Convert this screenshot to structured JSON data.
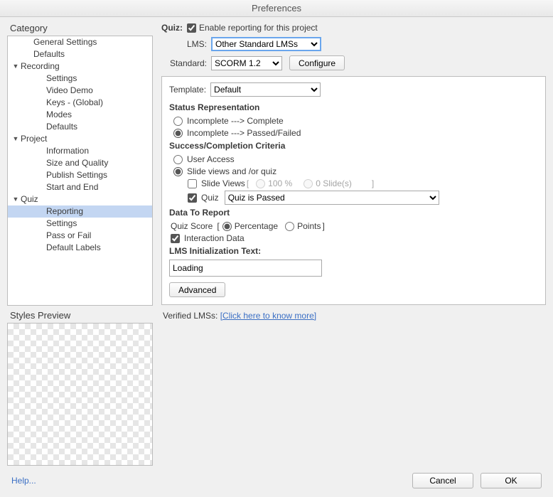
{
  "window": {
    "title": "Preferences"
  },
  "sidebar": {
    "heading": "Category",
    "preview_heading": "Styles Preview",
    "items": [
      {
        "label": "General Settings",
        "depth": 1,
        "arrow": ""
      },
      {
        "label": "Defaults",
        "depth": 1,
        "arrow": ""
      },
      {
        "label": "Recording",
        "depth": 0,
        "arrow": "▼"
      },
      {
        "label": "Settings",
        "depth": 2,
        "arrow": ""
      },
      {
        "label": "Video Demo",
        "depth": 2,
        "arrow": ""
      },
      {
        "label": "Keys - (Global)",
        "depth": 2,
        "arrow": ""
      },
      {
        "label": "Modes",
        "depth": 2,
        "arrow": ""
      },
      {
        "label": "Defaults",
        "depth": 2,
        "arrow": ""
      },
      {
        "label": "Project",
        "depth": 0,
        "arrow": "▼"
      },
      {
        "label": "Information",
        "depth": 2,
        "arrow": ""
      },
      {
        "label": "Size and Quality",
        "depth": 2,
        "arrow": ""
      },
      {
        "label": "Publish Settings",
        "depth": 2,
        "arrow": ""
      },
      {
        "label": "Start and End",
        "depth": 2,
        "arrow": ""
      },
      {
        "label": "Quiz",
        "depth": 0,
        "arrow": "▼"
      },
      {
        "label": "Reporting",
        "depth": 2,
        "arrow": "",
        "selected": true
      },
      {
        "label": "Settings",
        "depth": 2,
        "arrow": ""
      },
      {
        "label": "Pass or Fail",
        "depth": 2,
        "arrow": ""
      },
      {
        "label": "Default Labels",
        "depth": 2,
        "arrow": ""
      }
    ]
  },
  "form": {
    "quiz_label": "Quiz:",
    "enable_reporting": "Enable reporting for this project",
    "lms_label": "LMS:",
    "lms_value": "Other Standard LMSs",
    "standard_label": "Standard:",
    "standard_value": "SCORM 1.2",
    "configure": "Configure"
  },
  "panel": {
    "template_label": "Template:",
    "template_value": "Default",
    "status_heading": "Status Representation",
    "status_opt1": "Incomplete ---> Complete",
    "status_opt2": "Incomplete ---> Passed/Failed",
    "criteria_heading": "Success/Completion Criteria",
    "criteria_opt1": "User Access",
    "criteria_opt2": "Slide views and /or quiz",
    "slide_views_label": "Slide Views",
    "slide_views_percent": "100 %",
    "slide_views_count": "0 Slide(s)",
    "quiz_label": "Quiz",
    "quiz_value": "Quiz is Passed",
    "data_heading": "Data To Report",
    "score_label": "Quiz Score",
    "score_percentage": "Percentage",
    "score_points": "Points",
    "interaction_data": "Interaction Data",
    "lms_init_heading": "LMS Initialization Text:",
    "lms_init_value": "Loading",
    "advanced": "Advanced"
  },
  "verified": {
    "label": "Verified LMSs: ",
    "link": "[Click here to know more]"
  },
  "footer": {
    "help": "Help...",
    "cancel": "Cancel",
    "ok": "OK"
  }
}
